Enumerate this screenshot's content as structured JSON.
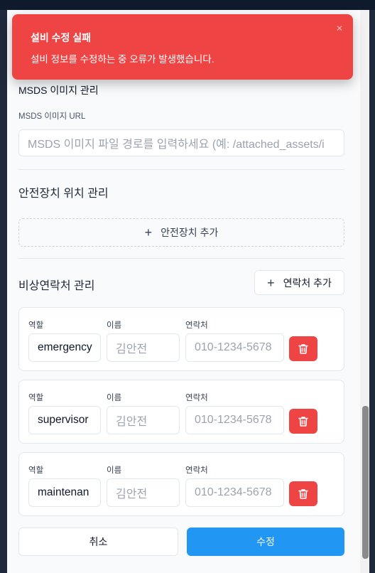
{
  "toast": {
    "title": "설비 수정 실패",
    "description": "설비 정보를 수정하는 중 오류가 발생했습니다.",
    "close_icon": "close-icon"
  },
  "msds": {
    "section_title": "MSDS 이미지 관리",
    "url_label": "MSDS 이미지 URL",
    "url_placeholder": "MSDS 이미지 파일 경로를 입력하세요 (예: /attached_assets/i"
  },
  "safety": {
    "section_title": "안전장치 위치 관리",
    "add_label": "안전장치 추가"
  },
  "emergency": {
    "section_title": "비상연락처 관리",
    "add_label": "연락처 추가",
    "col_role": "역할",
    "col_name": "이름",
    "col_phone": "연락처",
    "contacts": [
      {
        "role": "emergency",
        "name_placeholder": "김안전",
        "phone_placeholder": "010-1234-5678"
      },
      {
        "role": "supervisor",
        "name_placeholder": "김안전",
        "phone_placeholder": "010-1234-5678"
      },
      {
        "role": "maintenan",
        "name_placeholder": "김안전",
        "phone_placeholder": "010-1234-5678"
      }
    ]
  },
  "footer": {
    "cancel_label": "취소",
    "submit_label": "수정"
  },
  "colors": {
    "danger": "#ef4444",
    "primary": "#2196f3"
  }
}
